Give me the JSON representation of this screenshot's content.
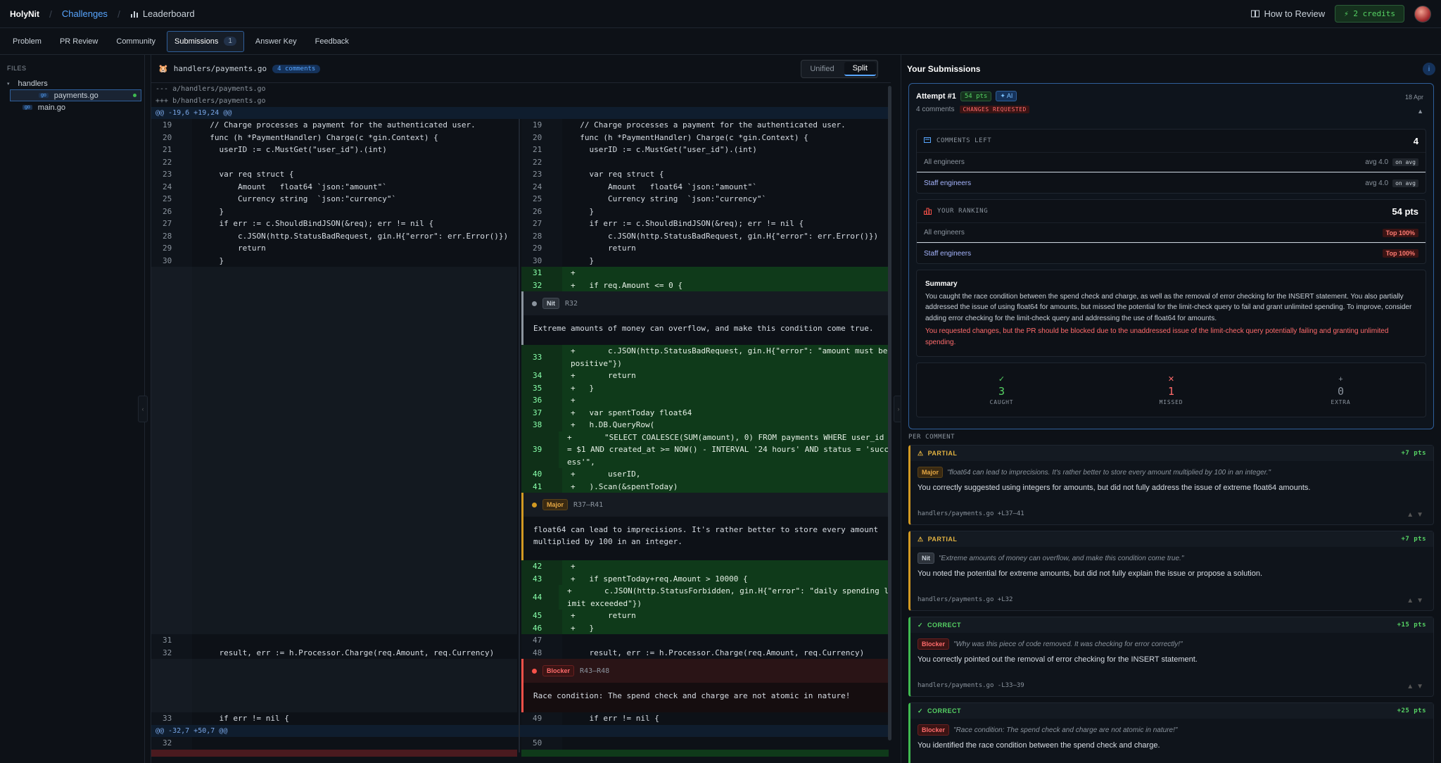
{
  "app": {
    "logo": "HolyNit",
    "breadcrumb": [
      "Challenges",
      "Leaderboard"
    ],
    "how_to": "How to Review",
    "credits": "⚡ 2 credits"
  },
  "tabs": [
    {
      "label": "Problem"
    },
    {
      "label": "PR Review"
    },
    {
      "label": "Community"
    },
    {
      "label": "Submissions",
      "badge": "1",
      "active": true
    },
    {
      "label": "Answer Key"
    },
    {
      "label": "Feedback"
    }
  ],
  "files": {
    "header": "FILES",
    "folder": "handlers",
    "items": [
      "payments.go",
      "main.go"
    ],
    "go_label": "go"
  },
  "diff": {
    "filename": "handlers/payments.go",
    "comment_count": "4 comments",
    "view_unified": "Unified",
    "view_split": "Split",
    "meta_a": "--- a/handlers/payments.go",
    "meta_b": "+++ b/handlers/payments.go",
    "hunk1": "@@ -19,6 +19,24 @@",
    "hunk2": "@@ -32,7 +50,7 @@",
    "left": [
      {
        "n": "19",
        "c": "  // Charge processes a payment for the authenticated user."
      },
      {
        "n": "20",
        "c": "  func (h *PaymentHandler) Charge(c *gin.Context) {"
      },
      {
        "n": "21",
        "c": "    userID := c.MustGet(\"user_id\").(int)"
      },
      {
        "n": "22",
        "c": ""
      },
      {
        "n": "23",
        "c": "    var req struct {"
      },
      {
        "n": "24",
        "c": "        Amount   float64 `json:\"amount\"`"
      },
      {
        "n": "25",
        "c": "        Currency string  `json:\"currency\"`"
      },
      {
        "n": "26",
        "c": "    }"
      },
      {
        "n": "27",
        "c": "    if err := c.ShouldBindJSON(&req); err != nil {"
      },
      {
        "n": "28",
        "c": "        c.JSON(http.StatusBadRequest, gin.H{\"error\": err.Error()})"
      },
      {
        "n": "29",
        "c": "        return"
      },
      {
        "n": "30",
        "c": "    }"
      }
    ],
    "left_tail": [
      {
        "n": "31",
        "c": ""
      },
      {
        "n": "32",
        "c": "    result, err := h.Processor.Charge(req.Amount, req.Currency)"
      }
    ],
    "left_after": {
      "n": "33",
      "c": "    if err != nil {"
    },
    "left_last": {
      "n": "32",
      "c": ""
    },
    "right": [
      {
        "n": "19",
        "c": "  // Charge processes a payment for the authenticated user."
      },
      {
        "n": "20",
        "c": "  func (h *PaymentHandler) Charge(c *gin.Context) {"
      },
      {
        "n": "21",
        "c": "    userID := c.MustGet(\"user_id\").(int)"
      },
      {
        "n": "22",
        "c": ""
      },
      {
        "n": "23",
        "c": "    var req struct {"
      },
      {
        "n": "24",
        "c": "        Amount   float64 `json:\"amount\"`"
      },
      {
        "n": "25",
        "c": "        Currency string  `json:\"currency\"`"
      },
      {
        "n": "26",
        "c": "    }"
      },
      {
        "n": "27",
        "c": "    if err := c.ShouldBindJSON(&req); err != nil {"
      },
      {
        "n": "28",
        "c": "        c.JSON(http.StatusBadRequest, gin.H{\"error\": err.Error()})"
      },
      {
        "n": "29",
        "c": "        return"
      },
      {
        "n": "30",
        "c": "    }"
      }
    ],
    "add1": [
      {
        "n": "31",
        "c": "+"
      },
      {
        "n": "32",
        "c": "+   if req.Amount <= 0 {"
      }
    ],
    "add2": [
      {
        "n": "33",
        "c": "+       c.JSON(http.StatusBadRequest, gin.H{\"error\": \"amount must be\npositive\"})",
        "h": 2
      },
      {
        "n": "34",
        "c": "+       return"
      },
      {
        "n": "35",
        "c": "+   }"
      },
      {
        "n": "36",
        "c": "+"
      },
      {
        "n": "37",
        "c": "+   var spentToday float64"
      },
      {
        "n": "38",
        "c": "+   h.DB.QueryRow("
      },
      {
        "n": "39",
        "c": "+       \"SELECT COALESCE(SUM(amount), 0) FROM payments WHERE user_id\n= $1 AND created_at >= NOW() - INTERVAL '24 hours' AND status = 'succ\ness'\",",
        "h": 3
      },
      {
        "n": "40",
        "c": "+       userID,"
      },
      {
        "n": "41",
        "c": "+   ).Scan(&spentToday)"
      }
    ],
    "add3": [
      {
        "n": "42",
        "c": "+"
      },
      {
        "n": "43",
        "c": "+   if spentToday+req.Amount > 10000 {"
      },
      {
        "n": "44",
        "c": "+       c.JSON(http.StatusForbidden, gin.H{\"error\": \"daily spending l\nimit exceeded\"})",
        "h": 2
      },
      {
        "n": "45",
        "c": "+       return"
      },
      {
        "n": "46",
        "c": "+   }"
      }
    ],
    "right_tail": [
      {
        "n": "47",
        "c": ""
      },
      {
        "n": "48",
        "c": "    result, err := h.Processor.Charge(req.Amount, req.Currency)"
      }
    ],
    "right_after": {
      "n": "49",
      "c": "    if err != nil {"
    },
    "right_last": {
      "n": "50",
      "c": ""
    },
    "comments": [
      {
        "sev": "Nit",
        "range": "R32",
        "body": "Extreme amounts of money can overflow, and make this condition come true."
      },
      {
        "sev": "Major",
        "range": "R37–R41",
        "body": "float64 can lead to imprecisions. It's rather better to store every amount multiplied by 100 in an integer."
      },
      {
        "sev": "Blocker",
        "range": "R43–R48",
        "body": "Race condition: The spend check and charge are not atomic in nature!"
      }
    ]
  },
  "submissions": {
    "title": "Your Submissions",
    "info": "i",
    "attempt": {
      "title": "Attempt #1",
      "pts": "54 pts",
      "ai": "✦ AI",
      "comments": "4 comments",
      "status": "CHANGES REQUESTED",
      "date": "18 Apr"
    },
    "comments_left": {
      "label": "COMMENTS LEFT",
      "value": "4",
      "rows": [
        {
          "name": "All engineers",
          "avg": "avg 4.0",
          "tag": "on avg"
        },
        {
          "name": "Staff engineers",
          "avg": "avg 4.0",
          "tag": "on avg"
        }
      ]
    },
    "ranking": {
      "label": "YOUR RANKING",
      "value": "54 pts",
      "rows": [
        {
          "name": "All engineers",
          "tag": "Top 100%"
        },
        {
          "name": "Staff engineers",
          "tag": "Top 100%"
        }
      ]
    },
    "summary": {
      "title": "Summary",
      "text": "You caught the race condition between the spend check and charge, as well as the removal of error checking for the INSERT statement. You also partially addressed the issue of using float64 for amounts, but missed the potential for the limit-check query to fail and grant unlimited spending. To improve, consider adding error checking for the limit-check query and addressing the use of float64 for amounts.",
      "warning": "You requested changes, but the PR should be blocked due to the unaddressed issue of the limit-check query potentially failing and granting unlimited spending."
    },
    "stats": [
      {
        "icon": "✓",
        "n": "3",
        "label": "CAUGHT",
        "color": "#56d364"
      },
      {
        "icon": "✕",
        "n": "1",
        "label": "MISSED",
        "color": "#ff6b6b"
      },
      {
        "icon": "+",
        "n": "0",
        "label": "EXTRA",
        "color": "#8b949e"
      }
    ],
    "per_comment_label": "PER COMMENT",
    "per_comment": [
      {
        "kind": "partial",
        "status": "PARTIAL",
        "pts": "+7 pts",
        "sev": "Major",
        "quote": "\"float64 can lead to imprecisions. It's rather better to store every amount multiplied by 100 in an integer.\"",
        "fb": "You correctly suggested using integers for amounts, but did not fully address the issue of extreme float64 amounts.",
        "loc": "handlers/payments.go +L37–41"
      },
      {
        "kind": "partial",
        "status": "PARTIAL",
        "pts": "+7 pts",
        "sev": "Nit",
        "quote": "\"Extreme amounts of money can overflow, and make this condition come true.\"",
        "fb": "You noted the potential for extreme amounts, but did not fully explain the issue or propose a solution.",
        "loc": "handlers/payments.go +L32"
      },
      {
        "kind": "correct",
        "status": "CORRECT",
        "pts": "+15 pts",
        "sev": "Blocker",
        "quote": "\"Why was this piece of code removed. It was checking for error correctly!\"",
        "fb": "You correctly pointed out the removal of error checking for the INSERT statement.",
        "loc": "handlers/payments.go -L33–39"
      },
      {
        "kind": "correct",
        "status": "CORRECT",
        "pts": "+25 pts",
        "sev": "Blocker",
        "quote": "\"Race condition: The spend check and charge are not atomic in nature!\"",
        "fb": "You identified the race condition between the spend check and charge.",
        "loc": ""
      }
    ]
  }
}
